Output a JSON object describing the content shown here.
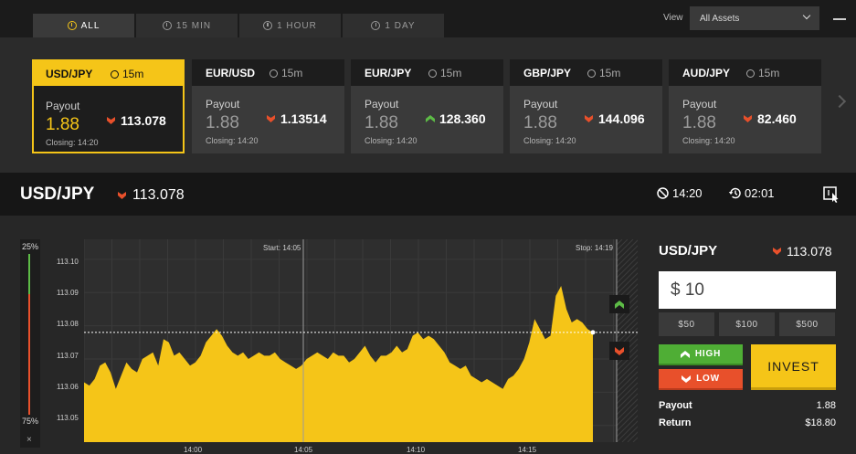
{
  "tabs": [
    {
      "label": "ALL",
      "active": true
    },
    {
      "label": "15 MIN",
      "active": false
    },
    {
      "label": "1 HOUR",
      "active": false
    },
    {
      "label": "1 DAY",
      "active": false
    }
  ],
  "view": {
    "label": "View",
    "selected": "All Assets"
  },
  "cards": [
    {
      "pair": "USD/JPY",
      "period": "15m",
      "payout_label": "Payout",
      "payout": "1.88",
      "direction": "down",
      "price": "113.078",
      "closing": "Closing: 14:20",
      "active": true
    },
    {
      "pair": "EUR/USD",
      "period": "15m",
      "payout_label": "Payout",
      "payout": "1.88",
      "direction": "down",
      "price": "1.13514",
      "closing": "Closing: 14:20",
      "active": false
    },
    {
      "pair": "EUR/JPY",
      "period": "15m",
      "payout_label": "Payout",
      "payout": "1.88",
      "direction": "up",
      "price": "128.360",
      "closing": "Closing: 14:20",
      "active": false
    },
    {
      "pair": "GBP/JPY",
      "period": "15m",
      "payout_label": "Payout",
      "payout": "1.88",
      "direction": "down",
      "price": "144.096",
      "closing": "Closing: 14:20",
      "active": false
    },
    {
      "pair": "AUD/JPY",
      "period": "15m",
      "payout_label": "Payout",
      "payout": "1.88",
      "direction": "down",
      "price": "82.460",
      "closing": "Closing: 14:20",
      "active": false
    }
  ],
  "asset": {
    "name": "USD/JPY",
    "price": "113.078",
    "closing_time": "14:20",
    "countdown": "02:01"
  },
  "sentiment": {
    "top": "25%",
    "bottom": "75%",
    "close": "×"
  },
  "chart": {
    "start_label": "Start: 14:05",
    "stop_label": "Stop: 14:19",
    "y_ticks": [
      "113.10",
      "113.09",
      "113.08",
      "113.07",
      "113.06",
      "113.05"
    ],
    "x_ticks": [
      "14:00",
      "14:05",
      "14:10",
      "14:15"
    ]
  },
  "chart_data": {
    "type": "area",
    "x_ticks": [
      "14:00",
      "14:05",
      "14:10",
      "14:15"
    ],
    "y_ticks": [
      113.1,
      113.09,
      113.08,
      113.07,
      113.06,
      113.05
    ],
    "ylim": [
      113.045,
      113.106
    ],
    "current_price": 113.078,
    "color": "#f5c518",
    "values": [
      113.063,
      113.062,
      113.064,
      113.068,
      113.069,
      113.066,
      113.061,
      113.065,
      113.069,
      113.067,
      113.066,
      113.07,
      113.071,
      113.072,
      113.068,
      113.076,
      113.075,
      113.071,
      113.072,
      113.07,
      113.068,
      113.069,
      113.071,
      113.075,
      113.077,
      113.079,
      113.077,
      113.074,
      113.072,
      113.071,
      113.072,
      113.07,
      113.071,
      113.072,
      113.071,
      113.071,
      113.072,
      113.07,
      113.069,
      113.068,
      113.067,
      113.068,
      113.07,
      113.071,
      113.072,
      113.071,
      113.07,
      113.072,
      113.071,
      113.071,
      113.069,
      113.07,
      113.072,
      113.074,
      113.071,
      113.069,
      113.071,
      113.071,
      113.072,
      113.074,
      113.072,
      113.073,
      113.077,
      113.078,
      113.076,
      113.077,
      113.076,
      113.074,
      113.072,
      113.069,
      113.068,
      113.067,
      113.068,
      113.065,
      113.064,
      113.063,
      113.064,
      113.063,
      113.062,
      113.061,
      113.064,
      113.065,
      113.067,
      113.07,
      113.075,
      113.082,
      113.079,
      113.076,
      113.077,
      113.089,
      113.092,
      113.085,
      113.081,
      113.082,
      113.081,
      113.079,
      113.078
    ]
  },
  "panel": {
    "name": "USD/JPY",
    "price": "113.078",
    "amount": "$ 10",
    "presets": [
      "$50",
      "$100",
      "$500"
    ],
    "high": "HIGH",
    "low": "LOW",
    "invest": "INVEST",
    "payout_label": "Payout",
    "payout": "1.88",
    "return_label": "Return",
    "return": "$18.80"
  },
  "colors": {
    "accent": "#f5c518",
    "up": "#5dbb46",
    "down": "#e8502b"
  }
}
